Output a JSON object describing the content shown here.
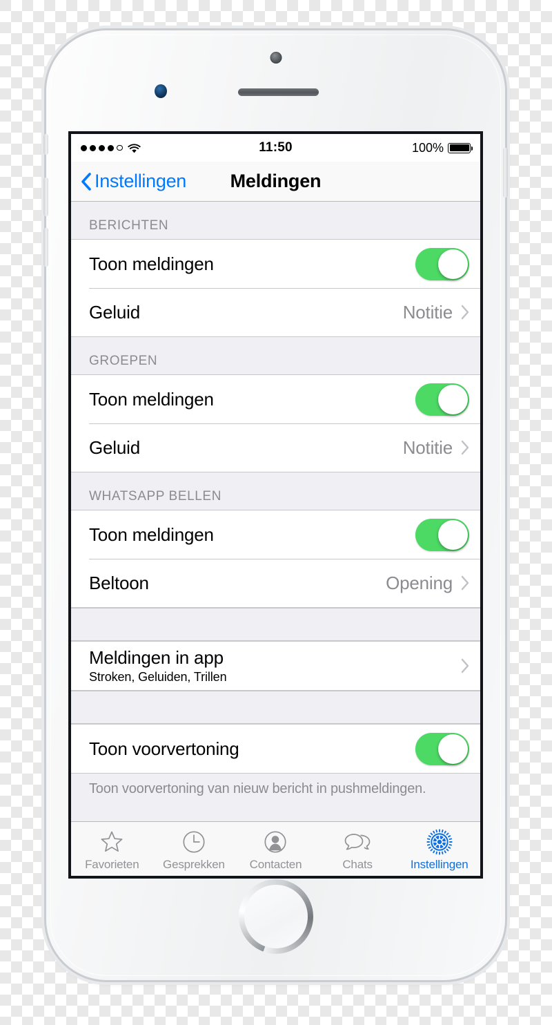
{
  "status_bar": {
    "signal_dots_filled": 4,
    "signal_dots_total": 5,
    "wifi_icon": "wifi-icon",
    "time": "11:50",
    "battery_percent": "100%",
    "battery_level": 100
  },
  "nav": {
    "back_label": "Instellingen",
    "back_icon": "chevron-left-icon",
    "title": "Meldingen"
  },
  "sections": [
    {
      "header": "BERICHTEN",
      "rows": [
        {
          "type": "toggle",
          "label": "Toon meldingen",
          "value_on": true
        },
        {
          "type": "value",
          "label": "Geluid",
          "value": "Notitie"
        }
      ]
    },
    {
      "header": "GROEPEN",
      "rows": [
        {
          "type": "toggle",
          "label": "Toon meldingen",
          "value_on": true
        },
        {
          "type": "value",
          "label": "Geluid",
          "value": "Notitie"
        }
      ]
    },
    {
      "header": "WHATSAPP BELLEN",
      "rows": [
        {
          "type": "toggle",
          "label": "Toon meldingen",
          "value_on": true
        },
        {
          "type": "value",
          "label": "Beltoon",
          "value": "Opening"
        }
      ]
    },
    {
      "header": "",
      "rows": [
        {
          "type": "disclosure",
          "label": "Meldingen in app",
          "subtitle": "Stroken, Geluiden, Trillen"
        }
      ]
    },
    {
      "header": "",
      "rows": [
        {
          "type": "toggle",
          "label": "Toon voorvertoning",
          "value_on": true
        }
      ],
      "footer": "Toon voorvertoning van nieuw bericht in pushmeldingen."
    }
  ],
  "tabs": [
    {
      "label": "Favorieten",
      "icon": "star-icon",
      "active": false
    },
    {
      "label": "Gesprekken",
      "icon": "clock-icon",
      "active": false
    },
    {
      "label": "Contacten",
      "icon": "person-icon",
      "active": false
    },
    {
      "label": "Chats",
      "icon": "speech-bubbles-icon",
      "active": false
    },
    {
      "label": "Instellingen",
      "icon": "gear-icon",
      "active": true
    }
  ],
  "colors": {
    "accent_blue": "#007AFF",
    "tab_active_blue": "#1070E0",
    "toggle_green": "#4CD964",
    "group_bg": "#EFEFF4",
    "secondary_text": "#8B8B90",
    "separator": "#C8C7CC"
  }
}
